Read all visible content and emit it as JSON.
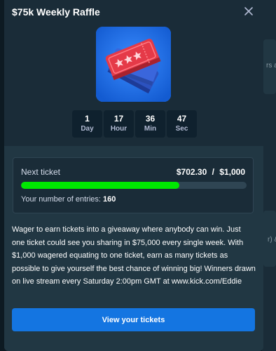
{
  "modal": {
    "title": "$75k Weekly Raffle",
    "close_icon": "close-icon"
  },
  "hero": {
    "icon": "raffle-tickets-icon",
    "colors": {
      "background": "#1c6fe0",
      "ticket_front": "#e53a48",
      "ticket_back": "#3059c9"
    }
  },
  "countdown": [
    {
      "value": "1",
      "unit": "Day"
    },
    {
      "value": "17",
      "unit": "Hour"
    },
    {
      "value": "36",
      "unit": "Min"
    },
    {
      "value": "47",
      "unit": "Sec"
    }
  ],
  "progress": {
    "label": "Next ticket",
    "current": "$702.30",
    "separator": "/",
    "target": "$1,000",
    "fraction": 0.7023,
    "entries_label": "Your number of entries:",
    "entries_value": "160"
  },
  "description": "Wager to earn tickets into a giveaway where anybody can win. Just one ticket could see you sharing in $75,000 every single week. With $1,000 wagered equating to one ticket, earn as many tickets as possible to give yourself the best chance of winning big! Winners drawn on live stream every Saturday 2:00pm GMT at www.kick.com/Eddie",
  "cta": {
    "label": "View your tickets"
  },
  "background_page": {
    "fragment_1": "rs a",
    "fragment_2": "r) &"
  },
  "colors": {
    "accent_button": "#1475e1",
    "progress_fill": "#00e701",
    "modal_bg": "#1a2c38",
    "lower_bg": "#213743"
  }
}
